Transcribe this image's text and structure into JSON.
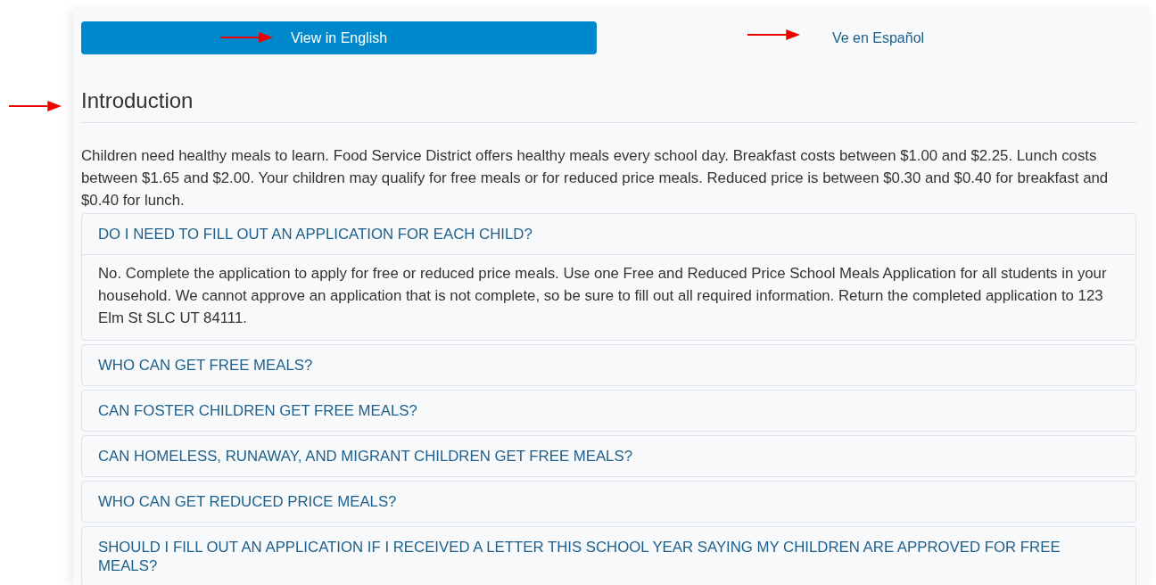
{
  "languages": [
    {
      "label": "View in English",
      "selected": true
    },
    {
      "label": "Ve en Español",
      "selected": false
    }
  ],
  "heading": "Introduction",
  "intro": "Children need healthy meals to learn. Food Service District offers healthy meals every school day. Breakfast costs between $1.00 and $2.25. Lunch costs between $1.65 and $2.00. Your children may qualify for free meals or for reduced price meals. Reduced price is between $0.30 and $0.40 for breakfast and $0.40 for lunch.",
  "faq": [
    {
      "question": "DO I NEED TO FILL OUT AN APPLICATION FOR EACH CHILD?",
      "answer": "No. Complete the application to apply for free or reduced price meals. Use one Free and Reduced Price School Meals Application for all students in your household. We cannot approve an application that is not complete, so be sure to fill out all required information. Return the completed application to 123 Elm St SLC UT 84111."
    },
    {
      "question": "WHO CAN GET FREE MEALS?"
    },
    {
      "question": "CAN FOSTER CHILDREN GET FREE MEALS?"
    },
    {
      "question": "CAN HOMELESS, RUNAWAY, AND MIGRANT CHILDREN GET FREE MEALS?"
    },
    {
      "question": "WHO CAN GET REDUCED PRICE MEALS?"
    },
    {
      "question": "SHOULD I FILL OUT AN APPLICATION IF I RECEIVED A LETTER THIS SCHOOL YEAR SAYING MY CHILDREN ARE APPROVED FOR FREE MEALS?"
    }
  ]
}
